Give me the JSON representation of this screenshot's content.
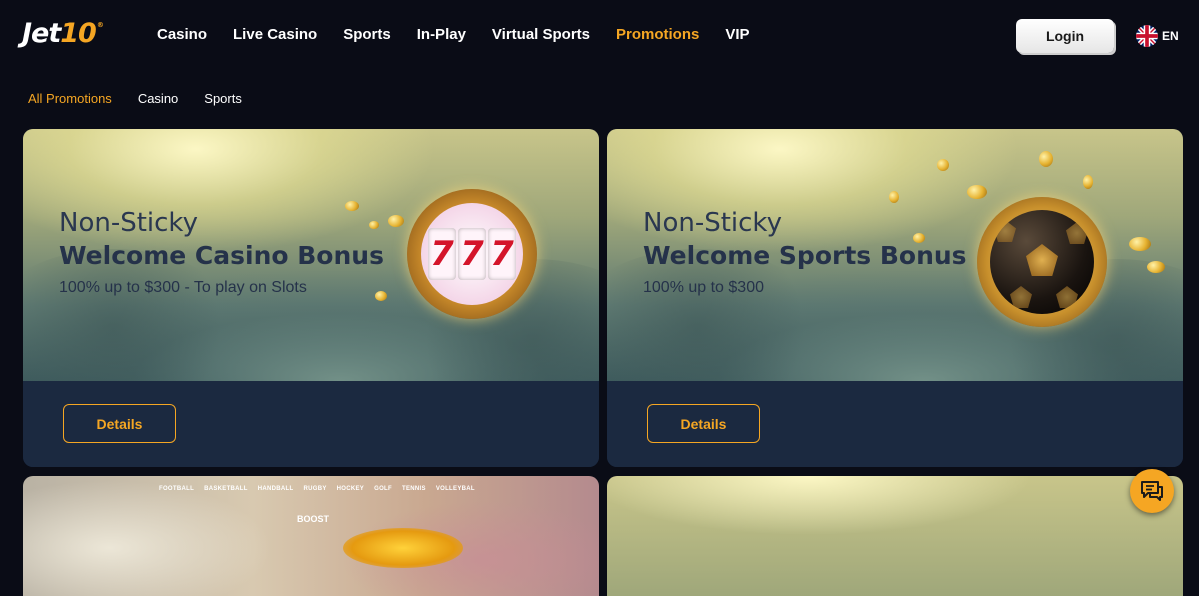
{
  "header": {
    "logo": {
      "main": "Jet",
      "accent": "10",
      "reg": "®"
    },
    "nav": [
      {
        "label": "Casino",
        "active": false
      },
      {
        "label": "Live Casino",
        "active": false
      },
      {
        "label": "Sports",
        "active": false
      },
      {
        "label": "In-Play",
        "active": false
      },
      {
        "label": "Virtual Sports",
        "active": false
      },
      {
        "label": "Promotions",
        "active": true
      },
      {
        "label": "VIP",
        "active": false
      }
    ],
    "login_label": "Login",
    "language": {
      "code": "EN",
      "flag_icon": "uk-flag-icon"
    }
  },
  "subnav": [
    {
      "label": "All Promotions",
      "active": true
    },
    {
      "label": "Casino",
      "active": false
    },
    {
      "label": "Sports",
      "active": false
    }
  ],
  "promos": [
    {
      "subtitle": "Non-Sticky",
      "title": "Welcome Casino Bonus",
      "description": "100% up to $300 - To play on Slots",
      "button_label": "Details",
      "graphic": "slot-777-icon",
      "reel_symbols": [
        "7",
        "7",
        "7"
      ]
    },
    {
      "subtitle": "Non-Sticky",
      "title": "Welcome Sports Bonus",
      "description": "100% up to $300",
      "button_label": "Details",
      "graphic": "football-icon"
    }
  ],
  "lower_promo": {
    "sport_tabs": [
      "FOOTBALL",
      "BASKETBALL",
      "HANDBALL",
      "RUGBY",
      "HOCKEY",
      "GOLF",
      "TENNIS",
      "VOLLEYBAL"
    ],
    "boost_label": "BOOST"
  },
  "colors": {
    "accent": "#f5a623",
    "background": "#0a0c16",
    "card_footer": "#1b2940",
    "card_text": "#25324a"
  },
  "chat": {
    "icon": "chat-icon"
  }
}
